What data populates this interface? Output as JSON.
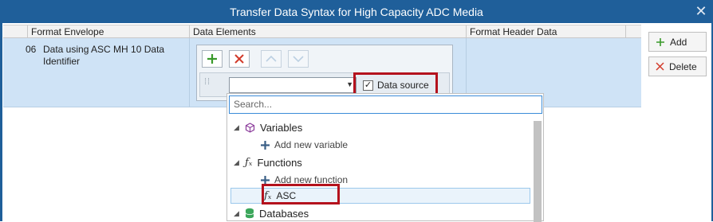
{
  "window": {
    "title": "Transfer Data Syntax for High Capacity ADC Media"
  },
  "grid": {
    "columns": [
      "Format Envelope",
      "Data Elements",
      "Format Header Data"
    ],
    "row": {
      "number": "06",
      "envelope": "Data using ASC MH 10 Data Identifier"
    }
  },
  "element_editor": {
    "combo_value": "",
    "data_source_label": "Data source",
    "data_source_checked": true
  },
  "side_buttons": {
    "add": "Add",
    "delete": "Delete"
  },
  "dropdown": {
    "search_placeholder": "Search...",
    "items": [
      {
        "label": "Variables",
        "type": "group"
      },
      {
        "label": "Add new variable",
        "type": "action"
      },
      {
        "label": "Functions",
        "type": "group"
      },
      {
        "label": "Add new function",
        "type": "action"
      },
      {
        "label": "ASC",
        "type": "function",
        "selected": true
      },
      {
        "label": "Databases",
        "type": "group"
      }
    ]
  },
  "colors": {
    "titlebar": "#1f5f9a",
    "row_selected": "#cfe3f6",
    "highlight": "#b4121d",
    "add_green": "#3a9a2a",
    "delete_red": "#d23a2a"
  }
}
